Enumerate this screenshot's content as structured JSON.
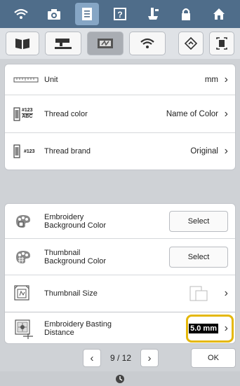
{
  "rows_top": [
    {
      "label": "Unit",
      "value": "mm"
    },
    {
      "label": "Thread color",
      "value": "Name of Color"
    },
    {
      "label": "Thread brand",
      "value": "Original"
    }
  ],
  "thread_color_icon_text": "#123",
  "thread_color_icon_sub": "ABC",
  "thread_brand_icon_text": "#123",
  "rows_bottom": {
    "emb_bg_label": "Embroidery\nBackground Color",
    "emb_bg_button": "Select",
    "thumb_bg_label": "Thumbnail\nBackground Color",
    "thumb_bg_button": "Select",
    "thumb_size_label": "Thumbnail Size",
    "basting_label": "Embroidery Basting\nDistance",
    "basting_value": "5.0 mm"
  },
  "pager": {
    "page": "9 / 12",
    "ok": "OK"
  }
}
